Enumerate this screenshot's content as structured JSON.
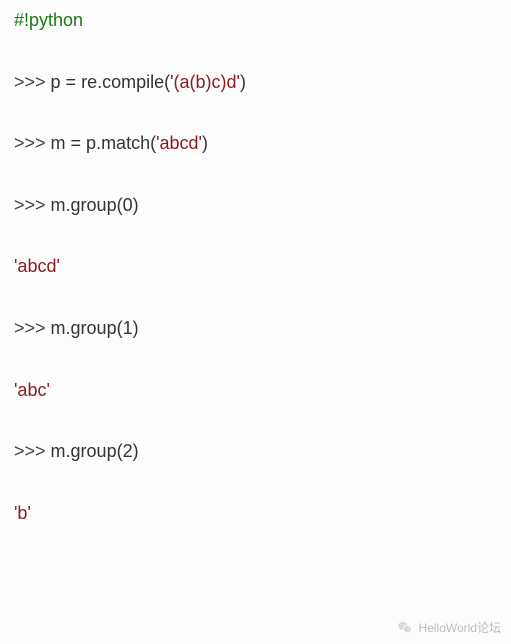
{
  "code": {
    "shebang": "#!python",
    "lines": [
      {
        "prompt": ">>> ",
        "pre": "p = re.compile(",
        "str": "'(a(b)c)d'",
        "post": ")"
      },
      {
        "prompt": ">>> ",
        "pre": "m = p.match(",
        "str": "'abcd'",
        "post": ")"
      },
      {
        "prompt": ">>> ",
        "pre": "m.group(0)",
        "str": "",
        "post": ""
      }
    ],
    "result1": "'abcd'",
    "lines2": [
      {
        "prompt": ">>> ",
        "pre": "m.group(1)",
        "str": "",
        "post": ""
      }
    ],
    "result2": "'abc'",
    "lines3": [
      {
        "prompt": ">>> ",
        "pre": "m.group(2)",
        "str": "",
        "post": ""
      }
    ],
    "result3": "'b'"
  },
  "watermark": {
    "text": "HelloWorld论坛"
  }
}
